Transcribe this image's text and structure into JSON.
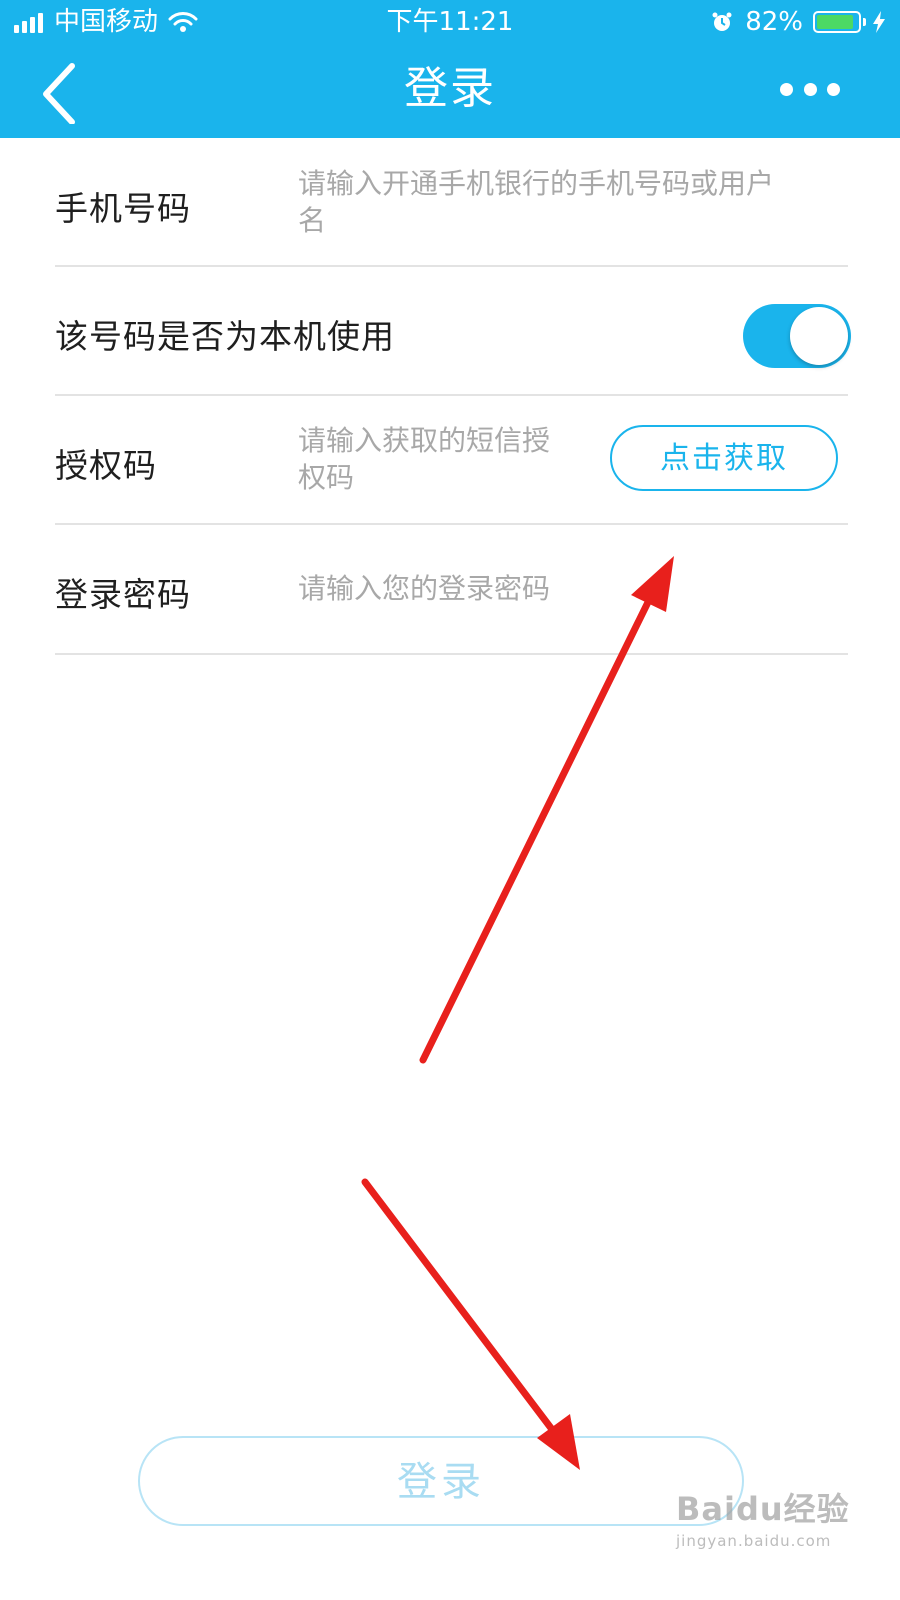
{
  "status_bar": {
    "carrier": "中国移动",
    "time": "下午11:21",
    "battery_percent": "82%",
    "battery_level": 0.82,
    "icons": [
      "signal-icon",
      "wifi-icon",
      "alarm-icon",
      "battery-icon",
      "charging-icon"
    ]
  },
  "nav": {
    "title": "登录",
    "icons": [
      "back-chevron-icon",
      "more-dots-icon"
    ]
  },
  "form": {
    "phone": {
      "label": "手机号码",
      "placeholder": "请输入开通手机银行的手机号码或用户名",
      "value": ""
    },
    "own_device": {
      "label": "该号码是否为本机使用",
      "enabled": true
    },
    "auth_code": {
      "label": "授权码",
      "placeholder": "请输入获取的短信授权码",
      "value": "",
      "get_button": "点击获取"
    },
    "password": {
      "label": "登录密码",
      "placeholder": "请输入您的登录密码",
      "value": ""
    }
  },
  "login_button": "登录",
  "colors": {
    "accent": "#1ab4ec",
    "annotation_arrow": "#e8201c",
    "disabled_button_text": "#a9dcf2"
  },
  "watermark": {
    "main": "Baidu经验",
    "sub": "jingyan.baidu.com"
  }
}
